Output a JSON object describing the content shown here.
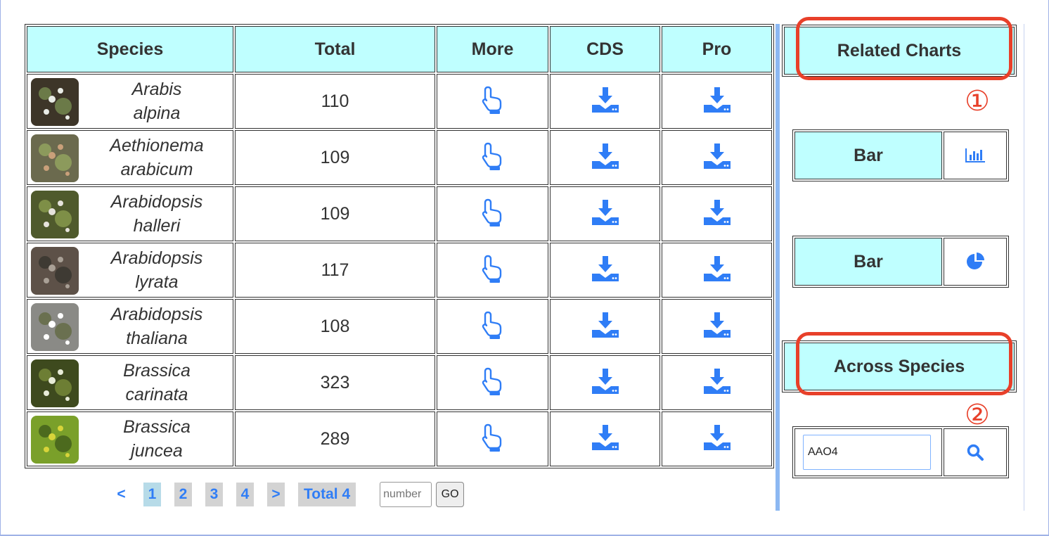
{
  "table": {
    "headers": [
      "Species",
      "Total",
      "More",
      "CDS",
      "Pro"
    ],
    "rows": [
      {
        "genus": "Arabis",
        "epithet": "alpina",
        "total": "110"
      },
      {
        "genus": "Aethionema",
        "epithet": "arabicum",
        "total": "109"
      },
      {
        "genus": "Arabidopsis",
        "epithet": "halleri",
        "total": "109"
      },
      {
        "genus": "Arabidopsis",
        "epithet": "lyrata",
        "total": "117"
      },
      {
        "genus": "Arabidopsis",
        "epithet": "thaliana",
        "total": "108"
      },
      {
        "genus": "Brassica",
        "epithet": "carinata",
        "total": "323"
      },
      {
        "genus": "Brassica",
        "epithet": "juncea",
        "total": "289"
      }
    ],
    "icons": {
      "more": "pointing-hand-icon",
      "cds": "download-icon",
      "pro": "download-icon"
    }
  },
  "pagination": {
    "prev": "<",
    "pages": [
      "1",
      "2",
      "3",
      "4"
    ],
    "current": "1",
    "next": ">",
    "total": "Total 4",
    "number_placeholder": "number",
    "go": "GO"
  },
  "sidebar": {
    "related_title": "Related Charts",
    "marker_1": "①",
    "charts": [
      {
        "label": "Bar",
        "icon": "bar-chart-icon"
      },
      {
        "label": "Bar",
        "icon": "pie-chart-icon"
      }
    ],
    "across_title": "Across Species",
    "marker_2": "②",
    "search_value": "AAO4",
    "search_icon": "search-icon"
  },
  "colors": {
    "header_bg": "#bfffff",
    "accent_blue": "#2f7df6",
    "annotation_red": "#e8402a",
    "separator_blue": "#8cb8f2"
  }
}
